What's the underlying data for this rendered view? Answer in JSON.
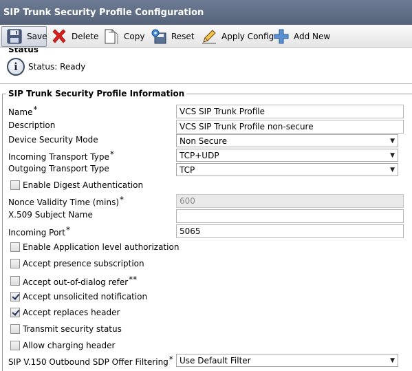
{
  "page_title": "SIP Trunk Security Profile Configuration",
  "toolbar": {
    "save": "Save",
    "delete": "Delete",
    "copy": "Copy",
    "reset": "Reset",
    "apply_config": "Apply Config",
    "add_new": "Add New"
  },
  "status": {
    "heading": "Status",
    "text": "Status: Ready"
  },
  "section": {
    "title": "SIP Trunk Security Profile Information"
  },
  "fields": {
    "name": {
      "label": "Name",
      "required": "*",
      "value": "VCS SIP Trunk Profile"
    },
    "description": {
      "label": "Description",
      "value": "VCS SIP Trunk Profile non-secure"
    },
    "device_security_mode": {
      "label": "Device Security Mode",
      "value": "Non Secure"
    },
    "incoming_transport": {
      "label": "Incoming Transport Type",
      "required": "*",
      "value": "TCP+UDP"
    },
    "outgoing_transport": {
      "label": "Outgoing Transport Type",
      "value": "TCP"
    },
    "enable_digest": {
      "label": "Enable Digest Authentication",
      "checked": false
    },
    "nonce_validity": {
      "label": "Nonce Validity Time (mins)",
      "required": "*",
      "value": "600"
    },
    "x509_subject": {
      "label": "X.509 Subject Name",
      "value": ""
    },
    "incoming_port": {
      "label": "Incoming Port",
      "required": "*",
      "value": "5065"
    },
    "app_level_auth": {
      "label": "Enable Application level authorization",
      "checked": false
    },
    "presence_sub": {
      "label": "Accept presence subscription",
      "checked": false
    },
    "out_of_dialog": {
      "label": "Accept out-of-dialog refer",
      "required": "**",
      "checked": false
    },
    "unsolicited": {
      "label": "Accept unsolicited notification",
      "checked": true
    },
    "replaces_header": {
      "label": "Accept replaces header",
      "checked": true
    },
    "transmit_security": {
      "label": "Transmit security status",
      "checked": false
    },
    "charging_header": {
      "label": "Allow charging header",
      "checked": false
    },
    "sdp_filter": {
      "label": "SIP V.150 Outbound SDP Offer Filtering",
      "required": "*",
      "value": "Use Default Filter"
    }
  },
  "icons": {
    "save": "floppy-disk-icon",
    "delete": "red-x-icon",
    "copy": "copy-document-icon",
    "reset": "reset-icon",
    "apply_config": "pencil-icon",
    "add_new": "plus-icon",
    "status": "info-icon"
  },
  "colors": {
    "title_bar": "#5f6d86",
    "delete_red": "#d9201c",
    "add_blue": "#5a8fd0"
  }
}
